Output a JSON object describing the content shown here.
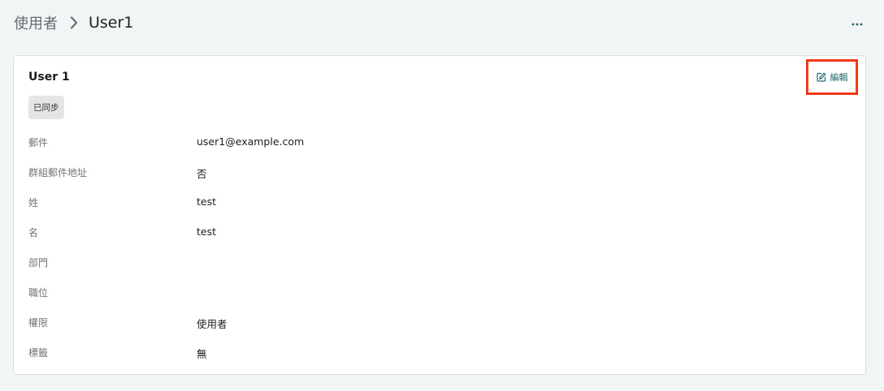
{
  "breadcrumb": {
    "parent": "使用者",
    "current": "User1"
  },
  "header": {
    "more_icon": "ellipsis-icon"
  },
  "card": {
    "title": "User 1",
    "status_badge": "已同步",
    "edit_label": "編輯",
    "edit_icon": "edit-icon",
    "fields": [
      {
        "label": "郵件",
        "value": "user1@example.com"
      },
      {
        "label": "群組郵件地址",
        "value": "否"
      },
      {
        "label": "姓",
        "value": "test"
      },
      {
        "label": "名",
        "value": "test"
      },
      {
        "label": "部門",
        "value": ""
      },
      {
        "label": "職位",
        "value": ""
      },
      {
        "label": "權限",
        "value": "使用者"
      },
      {
        "label": "標籤",
        "value": "無"
      }
    ]
  },
  "colors": {
    "accent": "#1f6b70",
    "highlight": "#f03a17",
    "background": "#f2f5f5"
  }
}
